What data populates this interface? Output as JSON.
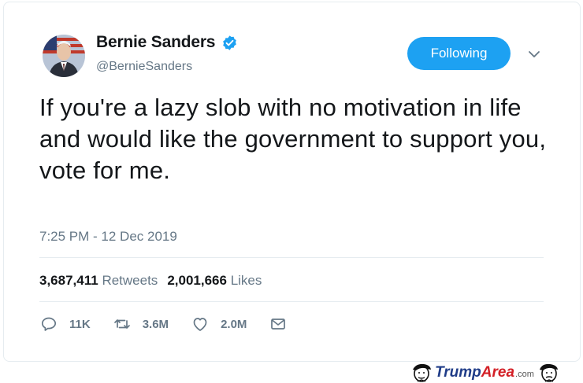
{
  "tweet": {
    "display_name": "Bernie Sanders",
    "handle": "@BernieSanders",
    "verified": true,
    "follow_label": "Following",
    "text": "If you're a lazy slob with no motivation in life and would like the government to support you, vote for me.",
    "timestamp": "7:25 PM - 12 Dec 2019",
    "retweets_count": "3,687,411",
    "retweets_label": "Retweets",
    "likes_count": "2,001,666",
    "likes_label": "Likes",
    "actions": {
      "reply_count": "11K",
      "retweet_count": "3.6M",
      "like_count": "2.0M"
    }
  },
  "watermark": {
    "brand_part1": "Trump",
    "brand_part2": "Area",
    "brand_suffix": ".com"
  },
  "colors": {
    "accent": "#1da1f2",
    "text_primary": "#14171a",
    "text_secondary": "#657786",
    "divider": "#e6ecf0"
  },
  "icons": [
    "verified-badge-icon",
    "chevron-down-icon",
    "reply-icon",
    "retweet-icon",
    "like-icon",
    "share-mail-icon"
  ]
}
